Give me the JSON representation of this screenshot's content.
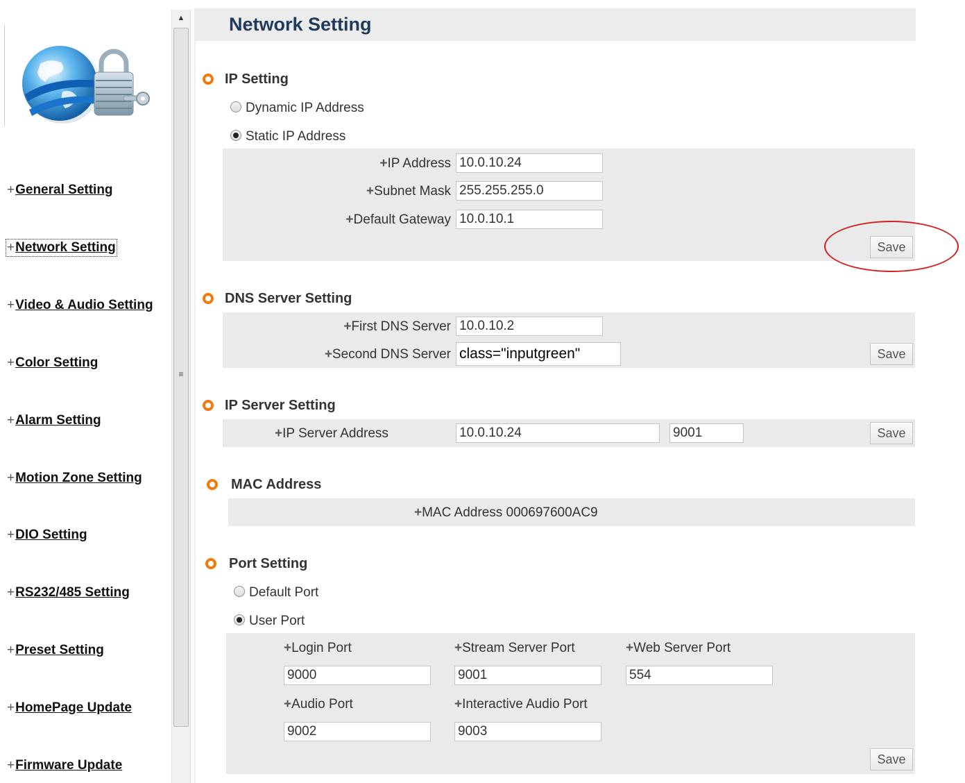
{
  "page": {
    "title": "Network Setting"
  },
  "sidebar": {
    "plus": "+",
    "items": [
      {
        "label": "General Setting"
      },
      {
        "label": "Network Setting",
        "active": true
      },
      {
        "label": "Video & Audio Setting"
      },
      {
        "label": "Color Setting"
      },
      {
        "label": "Alarm Setting"
      },
      {
        "label": "Motion Zone Setting"
      },
      {
        "label": "DIO Setting"
      },
      {
        "label": "RS232/485 Setting"
      },
      {
        "label": "Preset Setting"
      },
      {
        "label": "HomePage Update"
      },
      {
        "label": "Firmware Update"
      }
    ]
  },
  "ip_setting": {
    "title": "IP Setting",
    "dynamic_label": "Dynamic IP Address",
    "static_label": "Static IP Address",
    "selected": "static",
    "ip_address": {
      "label": "IP Address",
      "value": "10.0.10.24"
    },
    "subnet_mask": {
      "label": "Subnet Mask",
      "value": "255.255.255.0"
    },
    "default_gateway": {
      "label": "Default Gateway",
      "value": "10.0.10.1"
    },
    "save_label": "Save"
  },
  "dns_setting": {
    "title": "DNS Server Setting",
    "first_dns": {
      "label": "First DNS Server",
      "value": "10.0.10.2"
    },
    "second_dns": {
      "label": "Second DNS Server",
      "value": "class=\"inputgreen\""
    },
    "save_label": "Save"
  },
  "ip_server_setting": {
    "title": "IP Server Setting",
    "address": {
      "label": "IP Server Address",
      "value": "10.0.10.24",
      "port": "9001"
    },
    "save_label": "Save"
  },
  "mac_address": {
    "title": "MAC Address",
    "label": "MAC Address",
    "value": "000697600AC9"
  },
  "port_setting": {
    "title": "Port Setting",
    "default_label": "Default Port",
    "user_label": "User Port",
    "selected": "user",
    "login_port": {
      "label": "Login Port",
      "value": "9000"
    },
    "stream_server_port": {
      "label": "Stream Server Port",
      "value": "9001"
    },
    "web_server_port": {
      "label": "Web Server Port",
      "value": "554"
    },
    "audio_port": {
      "label": "Audio Port",
      "value": "9002"
    },
    "interactive_audio_port": {
      "label": "Interactive Audio Port",
      "value": "9003"
    },
    "save_label": "Save"
  },
  "colors": {
    "accent": "#f07a10",
    "title": "#1f3b5c",
    "panel": "#eaeaea",
    "highlight": "#d21f1f"
  }
}
